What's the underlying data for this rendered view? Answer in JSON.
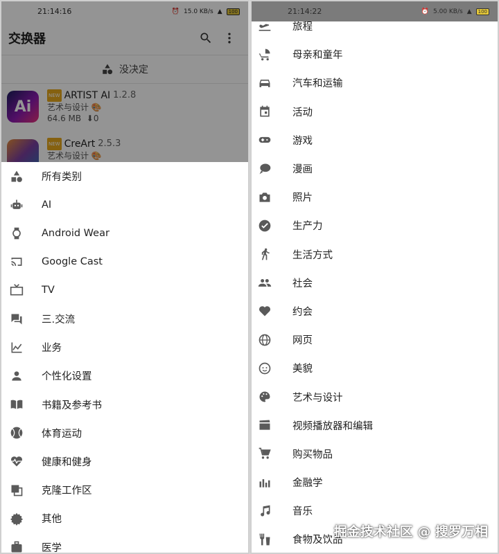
{
  "left": {
    "status": {
      "time": "21:14:16",
      "signal": "15.0 KB/s",
      "battery": "100"
    },
    "appbar": {
      "title": "交换器",
      "search_icon": "search-icon",
      "more_icon": "more-vert-icon"
    },
    "undecided_label": "没决定",
    "apps": [
      {
        "name": "ARTIST AI",
        "version": "1.2.8",
        "category": "艺术与设计",
        "size": "64.6 MB",
        "downloads": "0",
        "icon_text": "Ai"
      },
      {
        "name": "CreArt",
        "version": "2.5.3",
        "category": "艺术与设计"
      }
    ],
    "categories": [
      {
        "label": "所有类别",
        "icon": "shapes-icon"
      },
      {
        "label": "AI",
        "icon": "robot-icon"
      },
      {
        "label": "Android Wear",
        "icon": "watch-icon"
      },
      {
        "label": "Google Cast",
        "icon": "cast-icon"
      },
      {
        "label": "TV",
        "icon": "tv-icon"
      },
      {
        "label": "三.交流",
        "icon": "chat-icon"
      },
      {
        "label": "业务",
        "icon": "chart-icon"
      },
      {
        "label": "个性化设置",
        "icon": "person-icon"
      },
      {
        "label": "书籍及参考书",
        "icon": "book-icon"
      },
      {
        "label": "体育运动",
        "icon": "ball-icon"
      },
      {
        "label": "健康和健身",
        "icon": "heart-pulse-icon"
      },
      {
        "label": "克隆工作区",
        "icon": "clone-icon"
      },
      {
        "label": "其他",
        "icon": "gear-icon"
      },
      {
        "label": "医学",
        "icon": "medical-bag-icon"
      }
    ]
  },
  "right": {
    "status": {
      "time": "21:14:22",
      "signal": "5.00 KB/s",
      "battery": "100"
    },
    "categories": [
      {
        "label": "旅程",
        "icon": "flight-icon"
      },
      {
        "label": "母亲和童年",
        "icon": "stroller-icon"
      },
      {
        "label": "汽车和运输",
        "icon": "car-icon"
      },
      {
        "label": "活动",
        "icon": "calendar-icon"
      },
      {
        "label": "游戏",
        "icon": "gamepad-icon"
      },
      {
        "label": "漫画",
        "icon": "speech-bubble-icon"
      },
      {
        "label": "照片",
        "icon": "camera-icon"
      },
      {
        "label": "生产力",
        "icon": "check-circle-icon"
      },
      {
        "label": "生活方式",
        "icon": "walk-icon"
      },
      {
        "label": "社会",
        "icon": "people-icon"
      },
      {
        "label": "约会",
        "icon": "heart-icon"
      },
      {
        "label": "网页",
        "icon": "globe-icon"
      },
      {
        "label": "美貌",
        "icon": "face-icon"
      },
      {
        "label": "艺术与设计",
        "icon": "palette-icon"
      },
      {
        "label": "视频播放器和编辑",
        "icon": "clapperboard-icon"
      },
      {
        "label": "购买物品",
        "icon": "cart-icon"
      },
      {
        "label": "金融学",
        "icon": "equalizer-icon"
      },
      {
        "label": "音乐",
        "icon": "music-note-icon"
      },
      {
        "label": "食物及饮品",
        "icon": "food-drink-icon"
      }
    ]
  },
  "watermark": "掘金技术社区 @ 搜罗万相"
}
